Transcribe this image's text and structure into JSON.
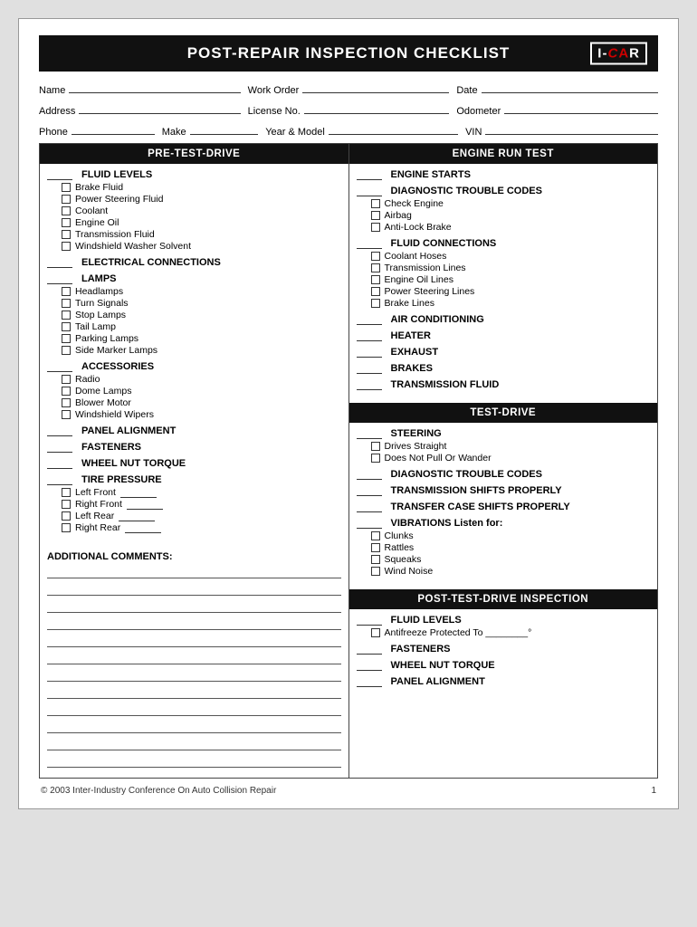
{
  "header": {
    "title": "POST-REPAIR INSPECTION CHECKLIST",
    "logo": "I-CAR"
  },
  "form": {
    "name_label": "Name",
    "work_order_label": "Work Order",
    "date_label": "Date",
    "address_label": "Address",
    "license_label": "License No.",
    "odometer_label": "Odometer",
    "phone_label": "Phone",
    "make_label": "Make",
    "year_model_label": "Year & Model",
    "vin_label": "VIN"
  },
  "left_column": {
    "header": "PRE-TEST-DRIVE",
    "groups": [
      {
        "id": "fluid-levels",
        "title": "FLUID LEVELS",
        "items": [
          "Brake Fluid",
          "Power Steering Fluid",
          "Coolant",
          "Engine Oil",
          "Transmission Fluid",
          "Windshield Washer Solvent"
        ]
      },
      {
        "id": "electrical-connections",
        "title": "ELECTRICAL CONNECTIONS",
        "items": []
      },
      {
        "id": "lamps",
        "title": "LAMPS",
        "items": [
          "Headlamps",
          "Turn Signals",
          "Stop Lamps",
          "Tail Lamp",
          "Parking Lamps",
          "Side Marker Lamps"
        ]
      },
      {
        "id": "accessories",
        "title": "ACCESSORIES",
        "items": [
          "Radio",
          "Dome Lamps",
          "Blower Motor",
          "Windshield Wipers"
        ]
      },
      {
        "id": "panel-alignment",
        "title": "PANEL ALIGNMENT",
        "items": []
      },
      {
        "id": "fasteners",
        "title": "FASTENERS",
        "items": []
      },
      {
        "id": "wheel-nut-torque",
        "title": "WHEEL NUT TORQUE",
        "items": []
      },
      {
        "id": "tire-pressure",
        "title": "TIRE PRESSURE",
        "items": [
          "Left Front",
          "Right Front",
          "Left Rear",
          "Right Rear"
        ]
      }
    ],
    "comments_label": "ADDITIONAL COMMENTS:",
    "comment_lines": 12
  },
  "right_column": {
    "sections": [
      {
        "id": "engine-run-test",
        "header": "ENGINE RUN TEST",
        "groups": [
          {
            "id": "engine-starts",
            "title": "ENGINE STARTS",
            "items": []
          },
          {
            "id": "dtc-engine",
            "title": "DIAGNOSTIC TROUBLE CODES",
            "items": [
              "Check Engine",
              "Airbag",
              "Anti-Lock Brake"
            ]
          },
          {
            "id": "fluid-connections",
            "title": "FLUID CONNECTIONS",
            "items": [
              "Coolant Hoses",
              "Transmission Lines",
              "Engine Oil Lines",
              "Power Steering Lines",
              "Brake Lines"
            ]
          },
          {
            "id": "air-conditioning",
            "title": "AIR CONDITIONING",
            "items": []
          },
          {
            "id": "heater",
            "title": "HEATER",
            "items": []
          },
          {
            "id": "exhaust",
            "title": "EXHAUST",
            "items": []
          },
          {
            "id": "brakes",
            "title": "BRAKES",
            "items": []
          },
          {
            "id": "transmission-fluid",
            "title": "TRANSMISSION FLUID",
            "items": []
          }
        ]
      },
      {
        "id": "test-drive",
        "header": "TEST-DRIVE",
        "groups": [
          {
            "id": "steering",
            "title": "STEERING",
            "items": [
              "Drives Straight",
              "Does Not Pull Or Wander"
            ]
          },
          {
            "id": "dtc-test",
            "title": "DIAGNOSTIC TROUBLE CODES",
            "items": []
          },
          {
            "id": "trans-shifts",
            "title": "TRANSMISSION SHIFTS PROPERLY",
            "items": []
          },
          {
            "id": "transfer-case",
            "title": "TRANSFER CASE SHIFTS PROPERLY",
            "items": []
          },
          {
            "id": "vibrations",
            "title": "VIBRATIONS Listen for:",
            "items": [
              "Clunks",
              "Rattles",
              "Squeaks",
              "Wind Noise"
            ]
          }
        ]
      },
      {
        "id": "post-test-drive",
        "header": "POST-TEST-DRIVE INSPECTION",
        "groups": [
          {
            "id": "fluid-levels-post",
            "title": "FLUID LEVELS",
            "items": [
              "Antifreeze Protected To ________°"
            ]
          },
          {
            "id": "fasteners-post",
            "title": "FASTENERS",
            "items": []
          },
          {
            "id": "wheel-nut-post",
            "title": "WHEEL NUT TORQUE",
            "items": []
          },
          {
            "id": "panel-alignment-post",
            "title": "PANEL ALIGNMENT",
            "items": []
          }
        ]
      }
    ]
  },
  "footer": {
    "copyright": "© 2003 Inter-Industry Conference On Auto Collision Repair",
    "page": "1"
  }
}
